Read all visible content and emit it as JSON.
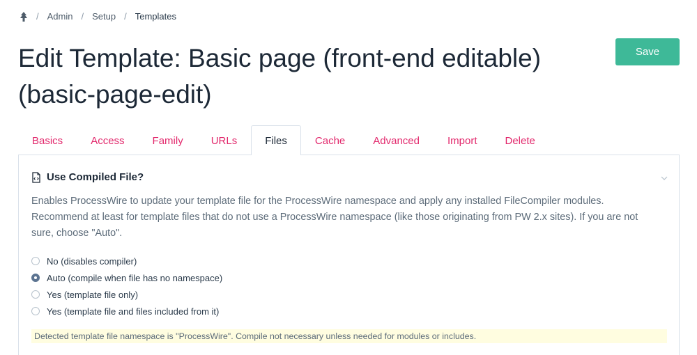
{
  "breadcrumb": {
    "home_icon": "tree-icon",
    "items": [
      "Admin",
      "Setup"
    ],
    "current": "Templates"
  },
  "page": {
    "title": "Edit Template: Basic page (front-end editable) (basic-page-edit)",
    "save_label": "Save"
  },
  "tabs": [
    "Basics",
    "Access",
    "Family",
    "URLs",
    "Files",
    "Cache",
    "Advanced",
    "Import",
    "Delete"
  ],
  "active_tab": "Files",
  "field": {
    "icon": "file-code-icon",
    "label": "Use Compiled File?",
    "description": "Enables ProcessWire to update your template file for the ProcessWire namespace and apply any installed FileCompiler modules. Recommend at least for template files that do not use a ProcessWire namespace (like those originating from PW 2.x sites). If you are not sure, choose \"Auto\".",
    "options": [
      {
        "label": "No (disables compiler)",
        "checked": false
      },
      {
        "label": "Auto (compile when file has no namespace)",
        "checked": true
      },
      {
        "label": "Yes (template file only)",
        "checked": false
      },
      {
        "label": "Yes (template file and files included from it)",
        "checked": false
      }
    ],
    "notes": "Detected template file namespace is \"ProcessWire\". Compile not necessary unless needed for modules or includes."
  },
  "colors": {
    "accent": "#e2286c",
    "save": "#3eb998",
    "notes_bg": "#fffde0"
  }
}
